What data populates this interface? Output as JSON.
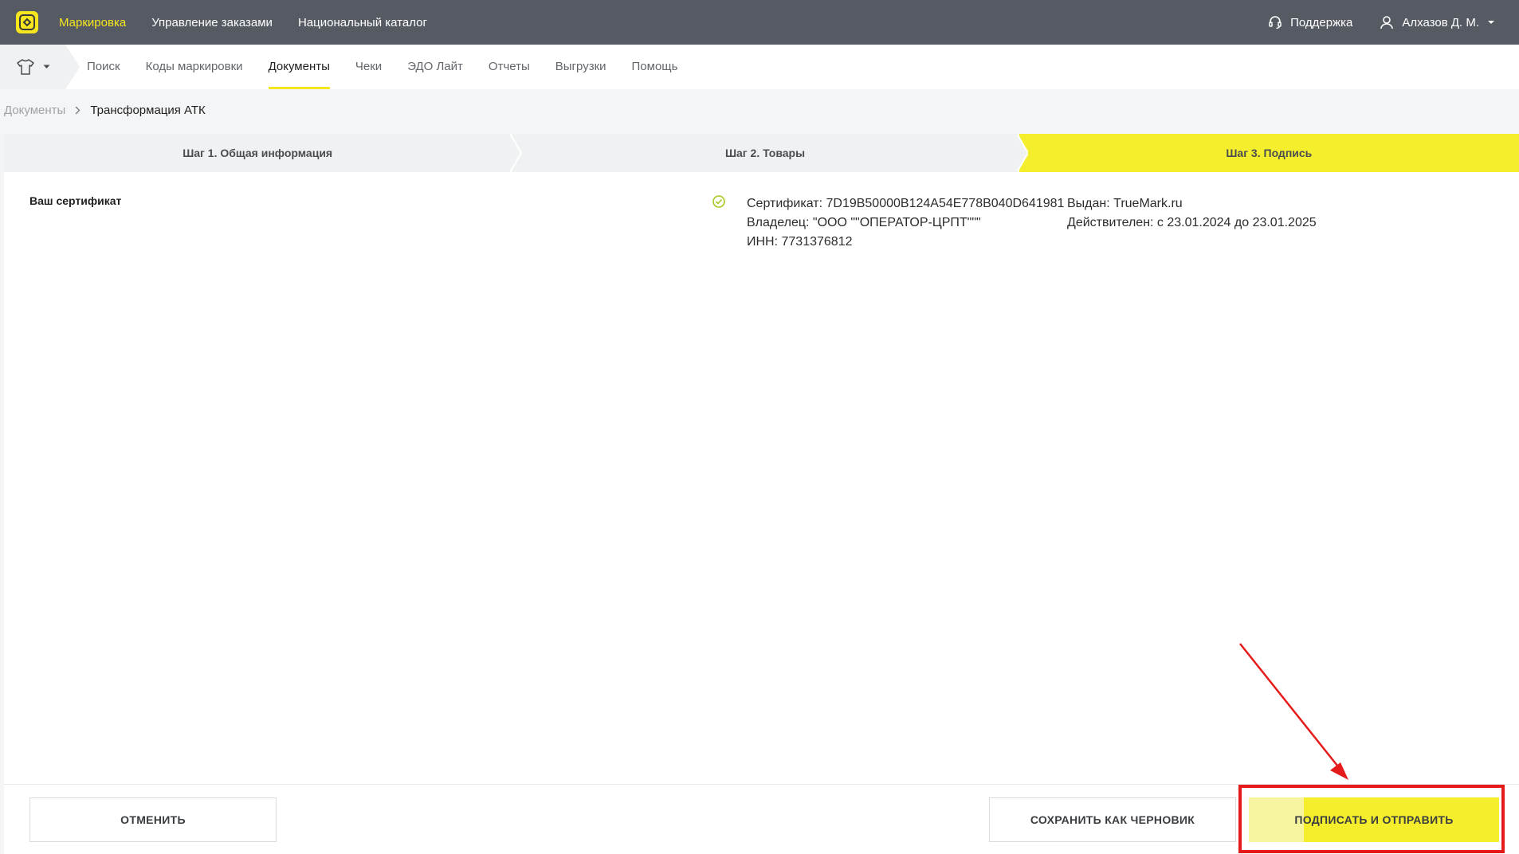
{
  "header": {
    "nav": [
      {
        "label": "Маркировка",
        "active": true
      },
      {
        "label": "Управление заказами",
        "active": false
      },
      {
        "label": "Национальный каталог",
        "active": false
      }
    ],
    "support_label": "Поддержка",
    "user_name": "Алхазов Д. М."
  },
  "subnav": {
    "category_icon": "tshirt-icon",
    "items": [
      {
        "label": "Поиск",
        "active": false
      },
      {
        "label": "Коды маркировки",
        "active": false
      },
      {
        "label": "Документы",
        "active": true
      },
      {
        "label": "Чеки",
        "active": false
      },
      {
        "label": "ЭДО Лайт",
        "active": false
      },
      {
        "label": "Отчеты",
        "active": false
      },
      {
        "label": "Выгрузки",
        "active": false
      },
      {
        "label": "Помощь",
        "active": false
      }
    ]
  },
  "breadcrumb": {
    "parent": "Документы",
    "current": "Трансформация АТК"
  },
  "steps": [
    {
      "label": "Шаг 1. Общая информация",
      "active": false
    },
    {
      "label": "Шаг 2. Товары",
      "active": false
    },
    {
      "label": "Шаг 3. Подпись",
      "active": true
    }
  ],
  "certificate": {
    "section_label": "Ваш сертификат",
    "number_line": "Сертификат: 7D19B50000B124A54E778B040D641981",
    "owner_line": "Владелец: \"ООО \"\"ОПЕРАТОР-ЦРПТ\"\"\"",
    "inn_line": "ИНН: 7731376812",
    "issuer_line": "Выдан: TrueMark.ru",
    "valid_line": "Действителен: с 23.01.2024 до 23.01.2025"
  },
  "footer": {
    "cancel_label": "ОТМЕНИТЬ",
    "draft_label": "СОХРАНИТЬ КАК ЧЕРНОВИК",
    "sign_label": "ПОДПИСАТЬ И ОТПРАВИТЬ"
  },
  "colors": {
    "header_bg": "#555a63",
    "accent": "#f5e61e",
    "annotation": "#e51b1b",
    "check": "#a7c91e"
  }
}
